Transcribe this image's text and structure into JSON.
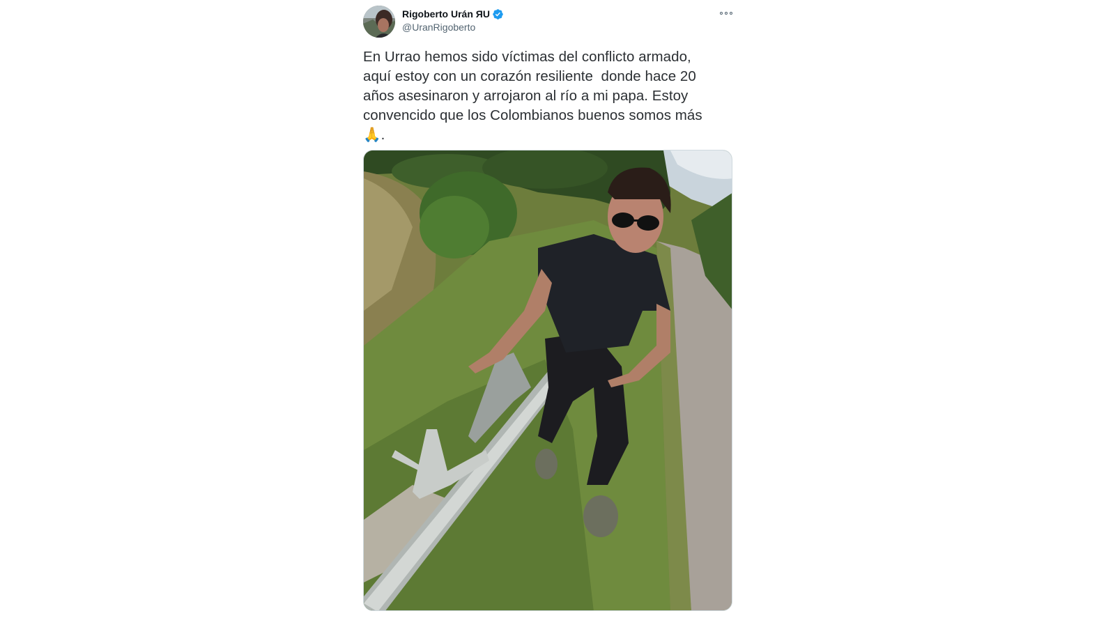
{
  "author": {
    "display_name": "Rigoberto Urán ЯU",
    "handle": "@UranRigoberto",
    "verified": true,
    "avatar_icon": "avatar-photo"
  },
  "tweet": {
    "text": "En Urrao hemos sido víctimas del conflicto armado,\naquí estoy con un corazón resiliente  donde hace 20\naños asesinaron y arrojaron al río a mi papa. Estoy\nconvencido que los Colombianos buenos somos más\n🙏.",
    "more_icon": "more-options-icon"
  },
  "colors": {
    "verified_blue": "#1d9bf0",
    "text_primary": "#0f1419",
    "text_secondary": "#536471"
  }
}
